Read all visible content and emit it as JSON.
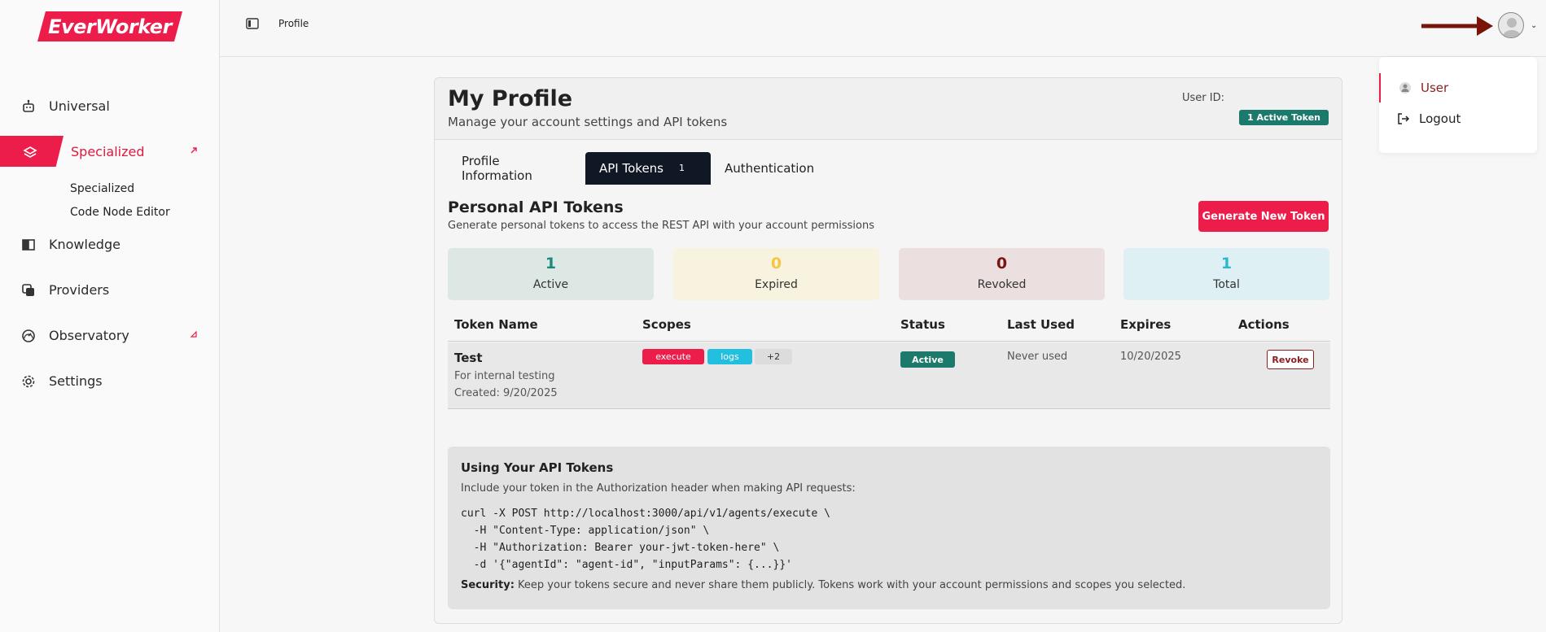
{
  "brand": {
    "name": "EverWorker",
    "accent": "#ec1d4a",
    "dark_tab": "#101725",
    "success": "#1b7a6b"
  },
  "sidebar": {
    "items": [
      {
        "label": "Universal",
        "icon": "robot-icon"
      },
      {
        "label": "Specialized",
        "icon": "layers-icon"
      },
      {
        "label": "Knowledge",
        "icon": "book-icon"
      },
      {
        "label": "Providers",
        "icon": "stack-icon"
      },
      {
        "label": "Observatory",
        "icon": "gauge-icon"
      },
      {
        "label": "Settings",
        "icon": "gear-icon"
      }
    ],
    "sub_items": [
      "Specialized",
      "Code Node Editor"
    ]
  },
  "topbar": {
    "breadcrumb": "Profile"
  },
  "user_menu": {
    "items": [
      {
        "label": "User",
        "icon": "user-icon"
      },
      {
        "label": "Logout",
        "icon": "logout-icon"
      }
    ]
  },
  "profile": {
    "title": "My Profile",
    "subtitle": "Manage your account settings and API tokens",
    "user_id_label": "User ID:",
    "active_token_badge": "1 Active Token"
  },
  "tabs": [
    {
      "label": "Profile Information"
    },
    {
      "label": "API Tokens",
      "count": "1"
    },
    {
      "label": "Authentication"
    }
  ],
  "tokens_section": {
    "title": "Personal API Tokens",
    "subtitle": "Generate personal tokens to access the REST API with your account permissions",
    "generate_label": "Generate New Token"
  },
  "stats": [
    {
      "value": "1",
      "label": "Active",
      "color": "#1b8a7a",
      "bg": "#dde7e4"
    },
    {
      "value": "0",
      "label": "Expired",
      "color": "#f2c744",
      "bg": "#f7f3df"
    },
    {
      "value": "0",
      "label": "Revoked",
      "color": "#7a1515",
      "bg": "#ebdfdf"
    },
    {
      "value": "1",
      "label": "Total",
      "color": "#2bb8cc",
      "bg": "#dff0f4"
    }
  ],
  "table": {
    "headers": [
      "Token Name",
      "Scopes",
      "Status",
      "Last Used",
      "Expires",
      "Actions"
    ],
    "rows": [
      {
        "name": "Test",
        "description": "For internal testing",
        "created": "Created: 9/20/2025",
        "scopes": [
          "execute",
          "logs",
          "+2"
        ],
        "status": "Active",
        "last_used": "Never used",
        "expires": "10/20/2025",
        "action": "Revoke"
      }
    ]
  },
  "usage": {
    "title": "Using Your API Tokens",
    "description": "Include your token in the Authorization header when making API requests:",
    "code": "curl -X POST http://localhost:3000/api/v1/agents/execute \\\n  -H \"Content-Type: application/json\" \\\n  -H \"Authorization: Bearer your-jwt-token-here\" \\\n  -d '{\"agentId\": \"agent-id\", \"inputParams\": {...}}'",
    "security_label": "Security:",
    "security_text": "Keep your tokens secure and never share them publicly. Tokens work with your account permissions and scopes you selected."
  }
}
